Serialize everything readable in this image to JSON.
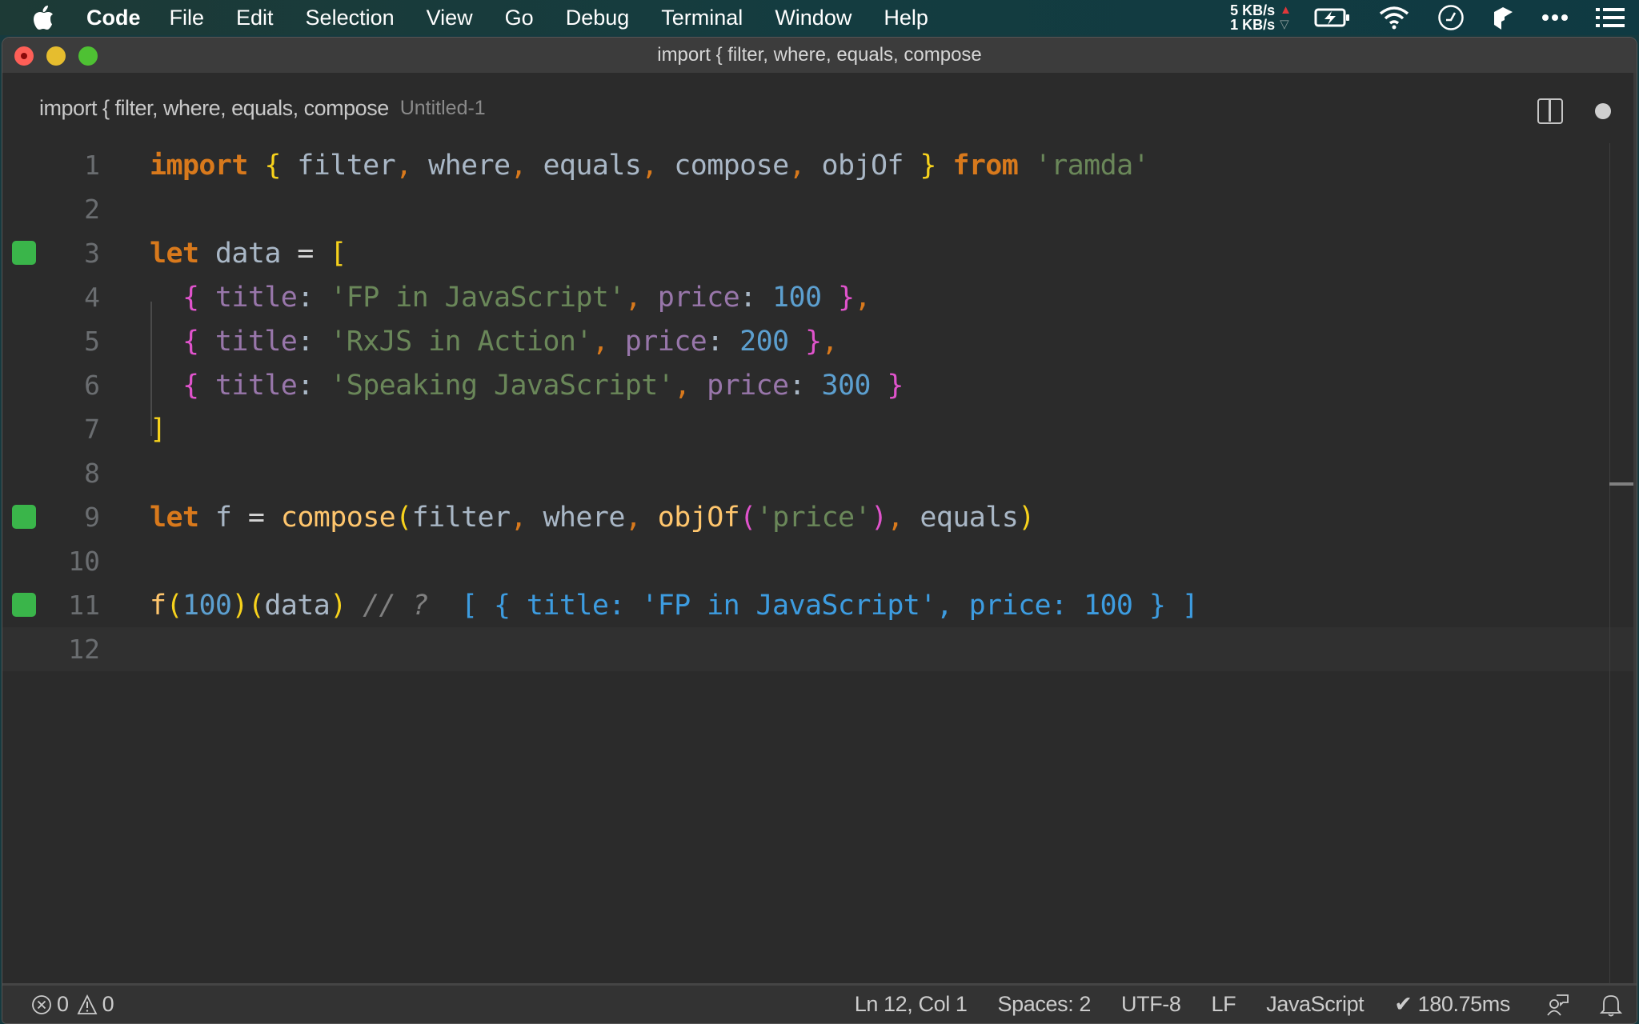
{
  "menubar": {
    "app_name": "Code",
    "items": [
      "File",
      "Edit",
      "Selection",
      "View",
      "Go",
      "Debug",
      "Terminal",
      "Window",
      "Help"
    ],
    "net_up": "5 KB/s",
    "net_down": "1 KB/s",
    "net_up_arrow": "▲",
    "net_down_arrow": "▽",
    "icons": [
      "battery-charging-icon",
      "wifi-icon",
      "clock-icon",
      "box-app-icon",
      "more-icon",
      "list-icon"
    ]
  },
  "window": {
    "title": "import { filter, where, equals, compose"
  },
  "tab": {
    "title": "import { filter, where, equals, compose",
    "description": "Untitled-1",
    "dirty": true
  },
  "editor": {
    "current_line": 12,
    "lines": [
      {
        "n": "1",
        "marker": false
      },
      {
        "n": "2",
        "marker": false
      },
      {
        "n": "3",
        "marker": true
      },
      {
        "n": "4",
        "marker": false
      },
      {
        "n": "5",
        "marker": false
      },
      {
        "n": "6",
        "marker": false
      },
      {
        "n": "7",
        "marker": false
      },
      {
        "n": "8",
        "marker": false
      },
      {
        "n": "9",
        "marker": true
      },
      {
        "n": "10",
        "marker": false
      },
      {
        "n": "11",
        "marker": true
      },
      {
        "n": "12",
        "marker": false
      }
    ],
    "code": {
      "l1": {
        "import": "import",
        "ob": "{",
        "a": "filter",
        "b": "where",
        "c": "equals",
        "d": "compose",
        "e": "objOf",
        "cb": "}",
        "from": "from",
        "mod": "'ramda'"
      },
      "l3": {
        "let": "let",
        "name": "data",
        "eq": "=",
        "ob": "["
      },
      "l4": {
        "title_key": "title",
        "title_val": "'FP in JavaScript'",
        "price_key": "price",
        "price_val": "100"
      },
      "l5": {
        "title_key": "title",
        "title_val": "'RxJS in Action'",
        "price_key": "price",
        "price_val": "200"
      },
      "l6": {
        "title_key": "title",
        "title_val": "'Speaking JavaScript'",
        "price_key": "price",
        "price_val": "300"
      },
      "l7": {
        "cb": "]"
      },
      "l9": {
        "let": "let",
        "name": "f",
        "eq": "=",
        "fn": "compose",
        "a": "filter",
        "b": "where",
        "c": "objOf",
        "c_arg": "'price'",
        "d": "equals"
      },
      "l11": {
        "fn": "f",
        "arg1": "100",
        "arg2": "data",
        "comment": "// ?",
        "result": "[ { title: 'FP in JavaScript', price: 100 } ]"
      }
    }
  },
  "statusbar": {
    "errors": "0",
    "warnings": "0",
    "position": "Ln 12, Col 1",
    "indent": "Spaces: 2",
    "encoding": "UTF-8",
    "eol": "LF",
    "language": "JavaScript",
    "timing": "✔ 180.75ms"
  },
  "colors": {
    "gutter_marker": "#3ab54a",
    "keyword": "#d8791c",
    "string": "#6a8759",
    "number": "#5c9fcf",
    "result": "#3d9ce0"
  }
}
